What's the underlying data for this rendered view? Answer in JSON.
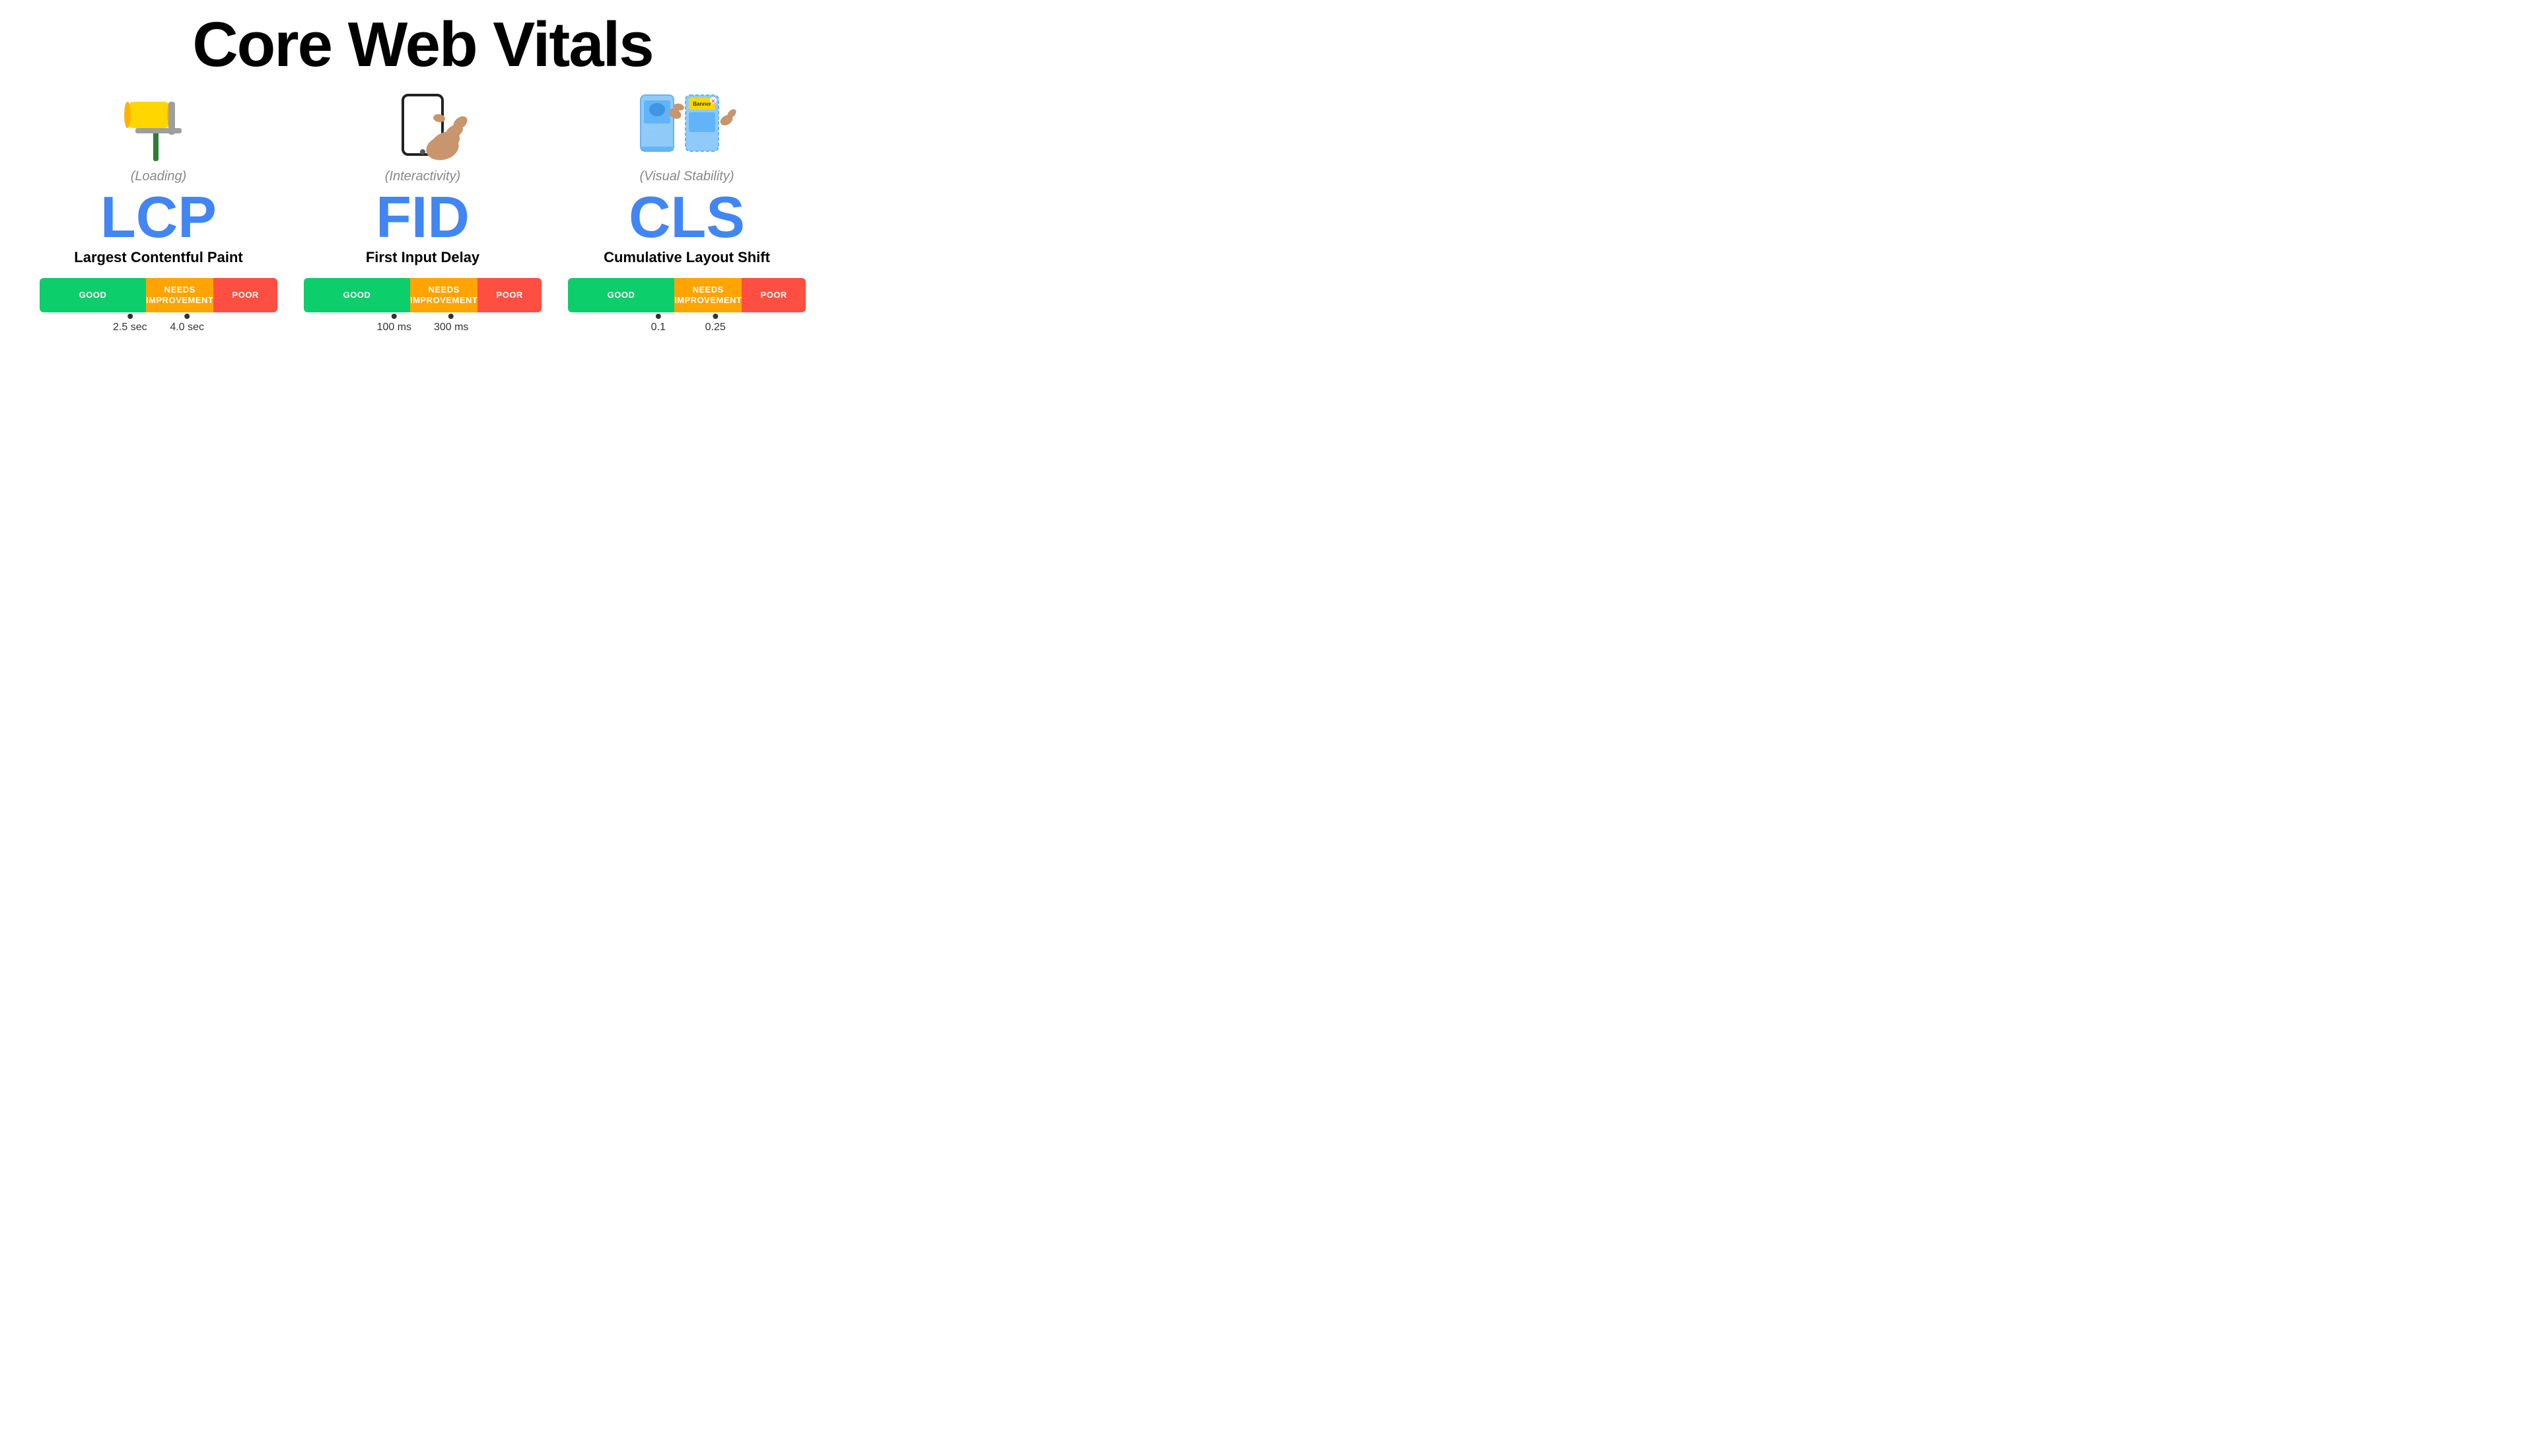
{
  "page": {
    "title": "Core Web Vitals"
  },
  "vitals": [
    {
      "id": "lcp",
      "category": "(Loading)",
      "acronym": "LCP",
      "fullname": "Largest Contentful Paint",
      "bar": {
        "good_label": "GOOD",
        "needs_label": "NEEDS\nIMPROVEMENT",
        "poor_label": "POOR"
      },
      "markers": [
        {
          "value": "2.5 sec",
          "position_pct": 39
        },
        {
          "value": "4.0 sec",
          "position_pct": 62
        }
      ]
    },
    {
      "id": "fid",
      "category": "(Interactivity)",
      "acronym": "FID",
      "fullname": "First Input Delay",
      "bar": {
        "good_label": "GOOD",
        "needs_label": "NEEDS\nIMPROVEMENT",
        "poor_label": "POOR"
      },
      "markers": [
        {
          "value": "100 ms",
          "position_pct": 39
        },
        {
          "value": "300 ms",
          "position_pct": 62
        }
      ]
    },
    {
      "id": "cls",
      "category": "(Visual Stability)",
      "acronym": "CLS",
      "fullname": "Cumulative Layout Shift",
      "bar": {
        "good_label": "GOOD",
        "needs_label": "NEEDS\nIMPROVEMENT",
        "poor_label": "POOR"
      },
      "markers": [
        {
          "value": "0.1",
          "position_pct": 39
        },
        {
          "value": "0.25",
          "position_pct": 62
        }
      ]
    }
  ],
  "colors": {
    "good": "#0CCE6B",
    "needs_improvement": "#FFA400",
    "poor": "#FF4E42",
    "accent_blue": "#4285F4"
  }
}
